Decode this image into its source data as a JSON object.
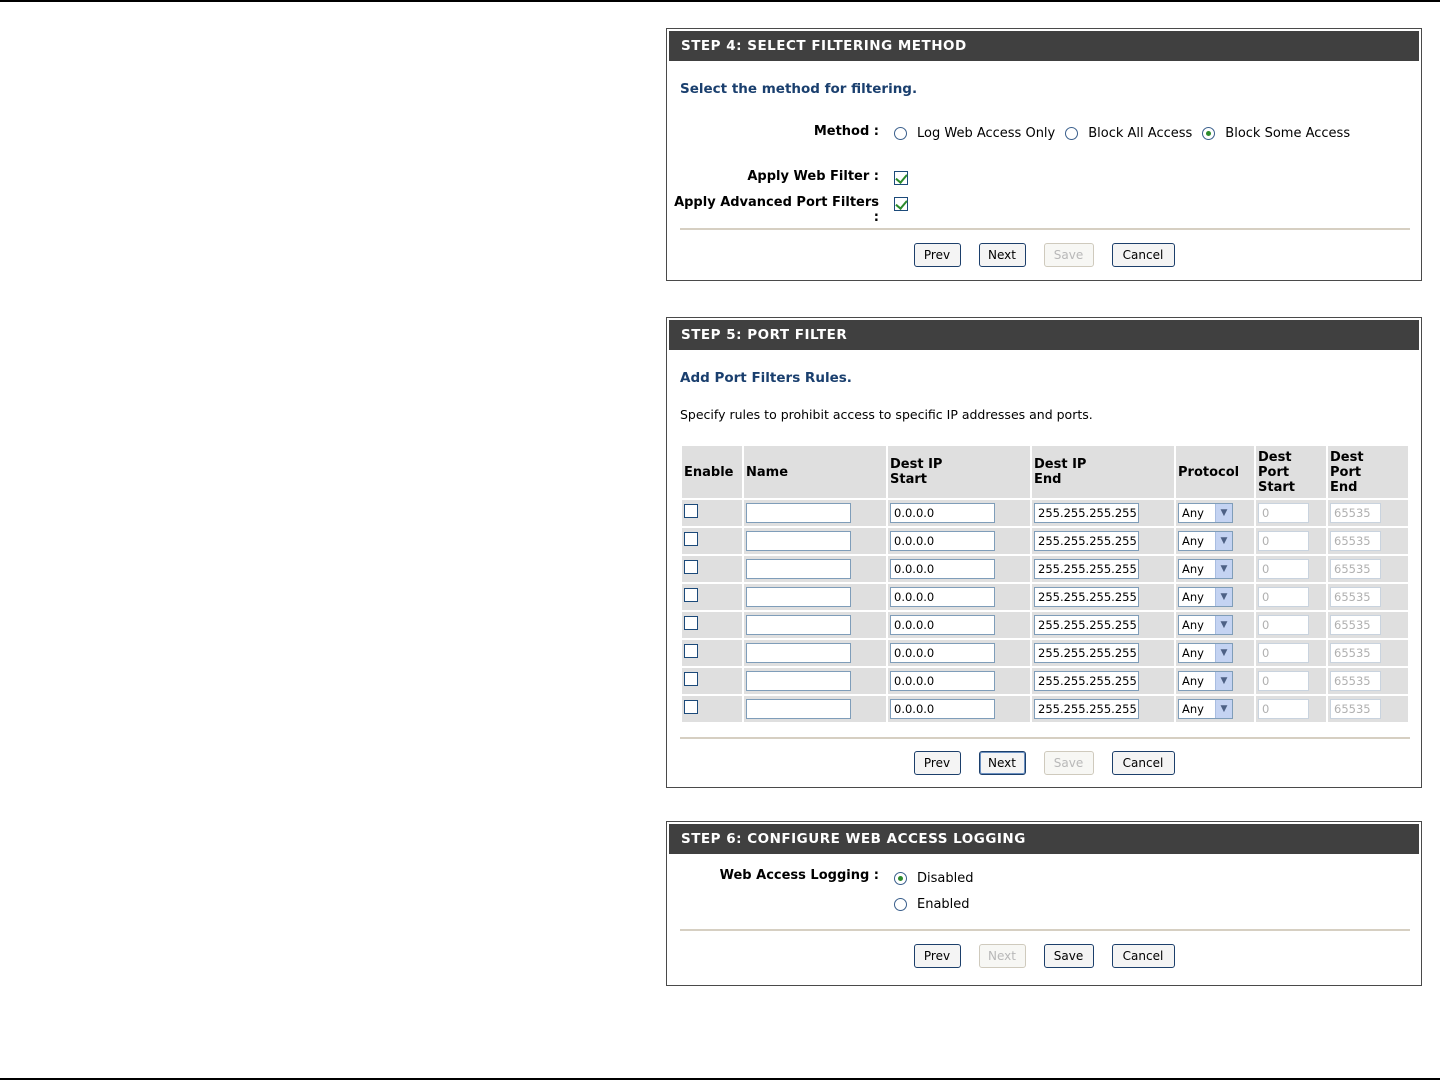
{
  "step4": {
    "title": "STEP 4: SELECT FILTERING METHOD",
    "heading": "Select the method for filtering.",
    "method_label": "Method :",
    "methods": [
      {
        "label": "Log Web Access Only",
        "selected": false
      },
      {
        "label": "Block All Access",
        "selected": false
      },
      {
        "label": "Block Some Access",
        "selected": true
      }
    ],
    "web_filter_label": "Apply Web Filter :",
    "web_filter_checked": true,
    "port_filter_label": "Apply Advanced Port Filters :",
    "port_filter_checked": true,
    "buttons": {
      "prev": "Prev",
      "next": "Next",
      "save": "Save",
      "cancel": "Cancel"
    }
  },
  "step5": {
    "title": "STEP 5: PORT FILTER",
    "heading": "Add Port Filters Rules.",
    "description": "Specify rules to prohibit access to specific IP addresses and ports.",
    "columns": {
      "enable": "Enable",
      "name": "Name",
      "ip_start_1": "Dest IP",
      "ip_start_2": "Start",
      "ip_end_1": "Dest IP",
      "ip_end_2": "End",
      "protocol": "Protocol",
      "port_start_1": "Dest",
      "port_start_2": "Port",
      "port_start_3": "Start",
      "port_end_1": "Dest",
      "port_end_2": "Port",
      "port_end_3": "End"
    },
    "rows": [
      {
        "enabled": false,
        "name": "",
        "ip_start": "0.0.0.0",
        "ip_end": "255.255.255.255",
        "protocol": "Any",
        "port_start": "0",
        "port_end": "65535"
      },
      {
        "enabled": false,
        "name": "",
        "ip_start": "0.0.0.0",
        "ip_end": "255.255.255.255",
        "protocol": "Any",
        "port_start": "0",
        "port_end": "65535"
      },
      {
        "enabled": false,
        "name": "",
        "ip_start": "0.0.0.0",
        "ip_end": "255.255.255.255",
        "protocol": "Any",
        "port_start": "0",
        "port_end": "65535"
      },
      {
        "enabled": false,
        "name": "",
        "ip_start": "0.0.0.0",
        "ip_end": "255.255.255.255",
        "protocol": "Any",
        "port_start": "0",
        "port_end": "65535"
      },
      {
        "enabled": false,
        "name": "",
        "ip_start": "0.0.0.0",
        "ip_end": "255.255.255.255",
        "protocol": "Any",
        "port_start": "0",
        "port_end": "65535"
      },
      {
        "enabled": false,
        "name": "",
        "ip_start": "0.0.0.0",
        "ip_end": "255.255.255.255",
        "protocol": "Any",
        "port_start": "0",
        "port_end": "65535"
      },
      {
        "enabled": false,
        "name": "",
        "ip_start": "0.0.0.0",
        "ip_end": "255.255.255.255",
        "protocol": "Any",
        "port_start": "0",
        "port_end": "65535"
      },
      {
        "enabled": false,
        "name": "",
        "ip_start": "0.0.0.0",
        "ip_end": "255.255.255.255",
        "protocol": "Any",
        "port_start": "0",
        "port_end": "65535"
      }
    ],
    "buttons": {
      "prev": "Prev",
      "next": "Next",
      "save": "Save",
      "cancel": "Cancel"
    }
  },
  "step6": {
    "title": "STEP 6: CONFIGURE WEB ACCESS LOGGING",
    "logging_label": "Web Access Logging :",
    "options": [
      {
        "label": "Disabled",
        "selected": true
      },
      {
        "label": "Enabled",
        "selected": false
      }
    ],
    "buttons": {
      "prev": "Prev",
      "next": "Next",
      "save": "Save",
      "cancel": "Cancel"
    }
  }
}
